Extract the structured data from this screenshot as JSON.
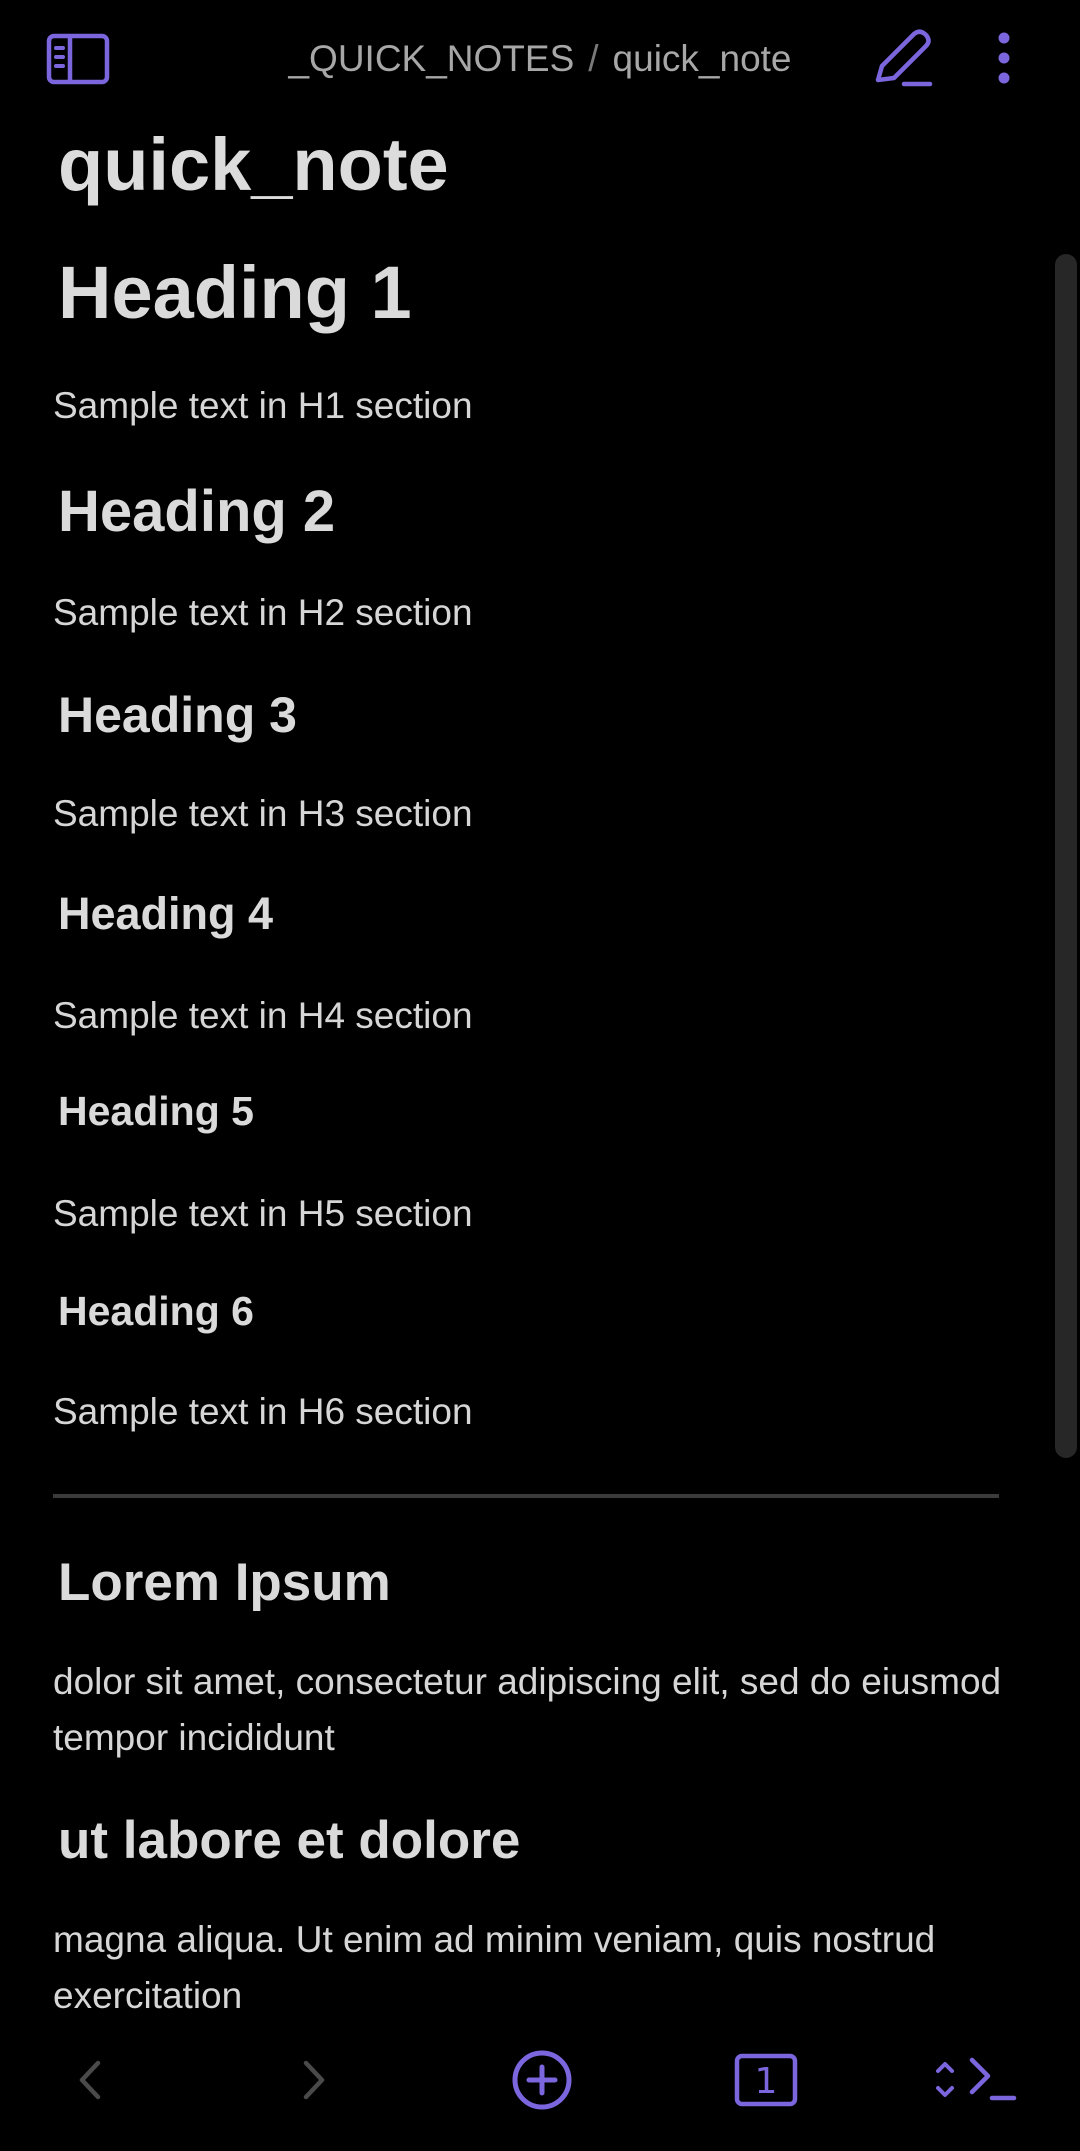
{
  "header": {
    "folder": "_QUICK_NOTES",
    "separator": "/",
    "note": "quick_note"
  },
  "note": {
    "title": "quick_note",
    "sections": [
      {
        "heading": "Heading 1",
        "text": "Sample text in H1 section"
      },
      {
        "heading": "Heading 2",
        "text": "Sample text in H2 section"
      },
      {
        "heading": "Heading 3",
        "text": "Sample text in H3 section"
      },
      {
        "heading": "Heading 4",
        "text": "Sample text in H4 section"
      },
      {
        "heading": "Heading 5",
        "text": "Sample text in H5 section"
      },
      {
        "heading": "Heading 6",
        "text": "Sample text in H6 section"
      }
    ],
    "lorem": {
      "heading": "Lorem Ipsum",
      "text": "dolor sit amet, consectetur adipiscing elit, sed do eiusmod tempor incididunt"
    },
    "ut": {
      "heading": "ut labore et dolore",
      "text": "magna aliqua. Ut enim ad minim veniam, quis nostrud exercitation"
    }
  },
  "bottom": {
    "tab_count": "1"
  },
  "icons": {
    "sidebar": "sidebar-toggle-icon",
    "edit": "pencil-icon",
    "more": "more-vertical-icon",
    "back": "chevron-left-icon",
    "forward": "chevron-right-icon",
    "new": "plus-circle-icon",
    "tabs": "tabs-icon",
    "command": "terminal-icon"
  },
  "colors": {
    "accent": "#7b66dd",
    "background": "#000000",
    "text": "#dadada",
    "muted": "#a7a7a7"
  }
}
